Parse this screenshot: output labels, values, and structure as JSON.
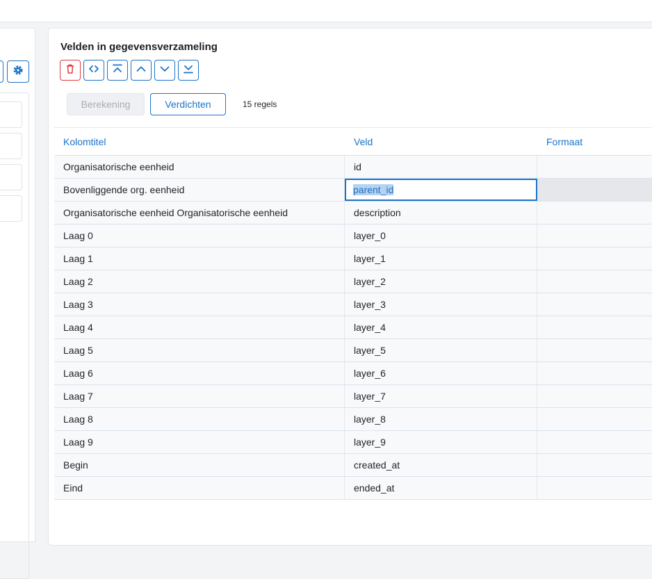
{
  "panel": {
    "title": "Velden in gegevensverzameling",
    "toolbar": [
      {
        "icon": "trash-icon",
        "label": "Verwijderen"
      },
      {
        "icon": "code-brackets-icon",
        "label": "Code"
      },
      {
        "icon": "move-top-icon",
        "label": "Naar boven"
      },
      {
        "icon": "chevron-up-icon",
        "label": "Omhoog"
      },
      {
        "icon": "chevron-down-icon",
        "label": "Omlaag"
      },
      {
        "icon": "move-bottom-icon",
        "label": "Naar onder"
      }
    ],
    "calc_button": "Berekening",
    "compact_button": "Verdichten",
    "row_count": "15 regels"
  },
  "table": {
    "headers": [
      "Kolomtitel",
      "Veld",
      "Formaat"
    ],
    "rows": [
      {
        "title": "Organisatorische eenheid",
        "field": "id",
        "format": ""
      },
      {
        "title": "Bovenliggende org. eenheid",
        "field": "parent_id",
        "format": ""
      },
      {
        "title": "Organisatorische eenheid Organisatorische eenheid",
        "field": "description",
        "format": ""
      },
      {
        "title": "Laag 0",
        "field": "layer_0",
        "format": ""
      },
      {
        "title": "Laag 1",
        "field": "layer_1",
        "format": ""
      },
      {
        "title": "Laag 2",
        "field": "layer_2",
        "format": ""
      },
      {
        "title": "Laag 3",
        "field": "layer_3",
        "format": ""
      },
      {
        "title": "Laag 4",
        "field": "layer_4",
        "format": ""
      },
      {
        "title": "Laag 5",
        "field": "layer_5",
        "format": ""
      },
      {
        "title": "Laag 6",
        "field": "layer_6",
        "format": ""
      },
      {
        "title": "Laag 7",
        "field": "layer_7",
        "format": ""
      },
      {
        "title": "Laag 8",
        "field": "layer_8",
        "format": ""
      },
      {
        "title": "Laag 9",
        "field": "layer_9",
        "format": ""
      },
      {
        "title": "Begin",
        "field": "created_at",
        "format": ""
      },
      {
        "title": "Eind",
        "field": "ended_at",
        "format": ""
      }
    ],
    "editing_row": 1
  },
  "colors": {
    "accent": "#1a73c8",
    "danger": "#e23b3b"
  },
  "left_panel": {
    "settings_icon": "gear-icon"
  }
}
